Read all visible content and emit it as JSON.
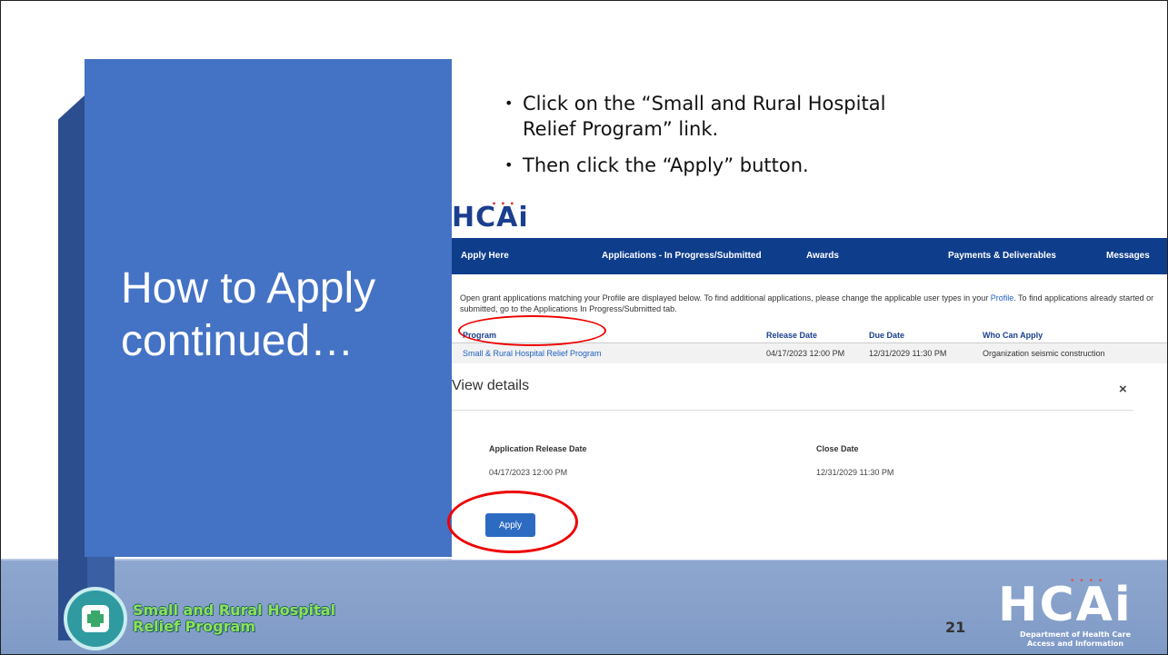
{
  "slide": {
    "title": "How to Apply continued…",
    "bullets": [
      "Click on the “Small and Rural Hospital Relief Program” link.",
      "Then click the “Apply” button."
    ],
    "page_number": "21",
    "colors": {
      "panel": "#4472c4",
      "band": "#8ea7cf",
      "nav": "#0e3d8c",
      "highlight_ring": "#ee0000"
    }
  },
  "screenshot": {
    "logo_text": "HCAi",
    "nav_items": [
      "Apply Here",
      "Applications - In Progress/Submitted",
      "Awards",
      "Payments & Deliverables",
      "Messages"
    ],
    "intro_text_before_link": "Open grant applications matching your Profile are displayed below. To find additional applications, please change the applicable user types in your ",
    "intro_link": "Profile",
    "intro_text_after_link": ".  To find applications already started or submitted, go to the Applications In Progress/Submitted tab.",
    "columns": [
      "Program",
      "Release Date",
      "Due Date",
      "Who Can Apply"
    ],
    "row": {
      "program": "Small & Rural Hospital Relief Program",
      "release_date": "04/17/2023 12:00 PM",
      "due_date": "12/31/2029 11:30 PM",
      "who_can_apply": "Organization seismic construction"
    },
    "view_details": {
      "title": "View details",
      "close_symbol": "×",
      "release_label": "Application Release Date",
      "release_value": "04/17/2023 12:00 PM",
      "close_label": "Close Date",
      "close_value": "12/31/2029 11:30 PM",
      "apply_button": "Apply"
    }
  },
  "footer": {
    "program_logo_line1": "Small and Rural Hospital",
    "program_logo_line2": "Relief Program",
    "hcai_letters": "HCAi",
    "hcai_subtitle": "Department of Health Care\nAccess and Information"
  }
}
